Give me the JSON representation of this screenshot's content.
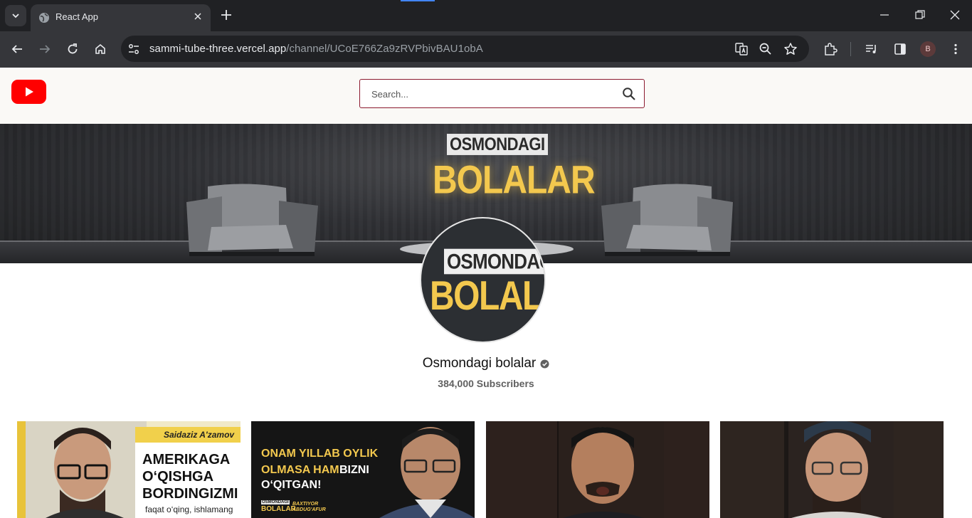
{
  "browser": {
    "tab_title": "React App",
    "url_host": "sammi-tube-three.vercel.app",
    "url_path": "/channel/UCoE766Za9zRVPbivBAU1obA",
    "profile_initial": "B"
  },
  "header": {
    "search_placeholder": "Search..."
  },
  "banner": {
    "brand_top": "OSMONDAGI",
    "brand_bottom": "BOLALAR"
  },
  "channel": {
    "avatar_top": "OSMONDAGI",
    "avatar_bottom": "BOLALAR",
    "name": "Osmondagi bolalar",
    "subscribers": "384,000 Subscribers"
  },
  "videos": [
    {
      "author": "Saidaziz A'zamov",
      "line1": "AMERIKAGA",
      "line2": "O‘QISHGA",
      "line3": "BORDINGIZMI",
      "tagline": "faqat o‘qing, ishlamang"
    },
    {
      "line1": "ONAM YILLAB OYLIK",
      "line2_a": "OLMASA HAM",
      "line2_b": "BIZNI",
      "line3": "O‘QITGAN!",
      "badge_top": "OSMONDAGI",
      "badge_bottom": "BOLALAR",
      "guest_first": "BAXTIYOR",
      "guest_last": "ABDUG'AFUR"
    },
    {},
    {}
  ],
  "colors": {
    "chrome_dark": "#202124",
    "chrome_mid": "#35363a",
    "header_bg": "#faf9f6",
    "search_border": "#8b1a2e",
    "youtube_red": "#ff0000",
    "brand_gold": "#f3c84e"
  }
}
